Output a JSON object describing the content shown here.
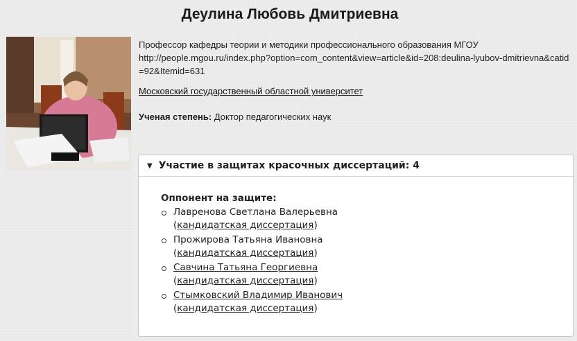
{
  "page": {
    "title": "Деулина Любовь Дмитриевна"
  },
  "profile": {
    "position": "Профессор кафедры теории и методики профессионального образования МГОУ",
    "url": "http://people.mgou.ru/index.php?option=com_content&view=article&id=208:deulina-lyubov-dmitrievna&catid=92&Itemid=631",
    "organization": "Московский государственный областной университет",
    "degree_label": "Ученая степень:",
    "degree_value": "Доктор педагогических наук"
  },
  "panel": {
    "header": "Участие в защитах красочных диссертаций: 4",
    "subheading": "Оппонент на защите:",
    "items": [
      {
        "name": "Лавренова Светлана Валерьевна",
        "name_linked": false,
        "open": "(",
        "link": "кандидатская диссертация",
        "close": ")"
      },
      {
        "name": "Прожирова Татьяна Ивановна",
        "name_linked": false,
        "open": "(",
        "link": "кандидатская диссертация",
        "close": ")"
      },
      {
        "name": "Савчина Татьяна Георгиевна",
        "name_linked": true,
        "open": "(",
        "link": "кандидатская диссертация",
        "close": ")"
      },
      {
        "name": "Стымковский Владимир Иванович",
        "name_linked": true,
        "open": "(",
        "link": "кандидатская диссертация",
        "close": ")"
      }
    ]
  },
  "icons": {
    "panel_toggle": "triangle-down-icon"
  }
}
